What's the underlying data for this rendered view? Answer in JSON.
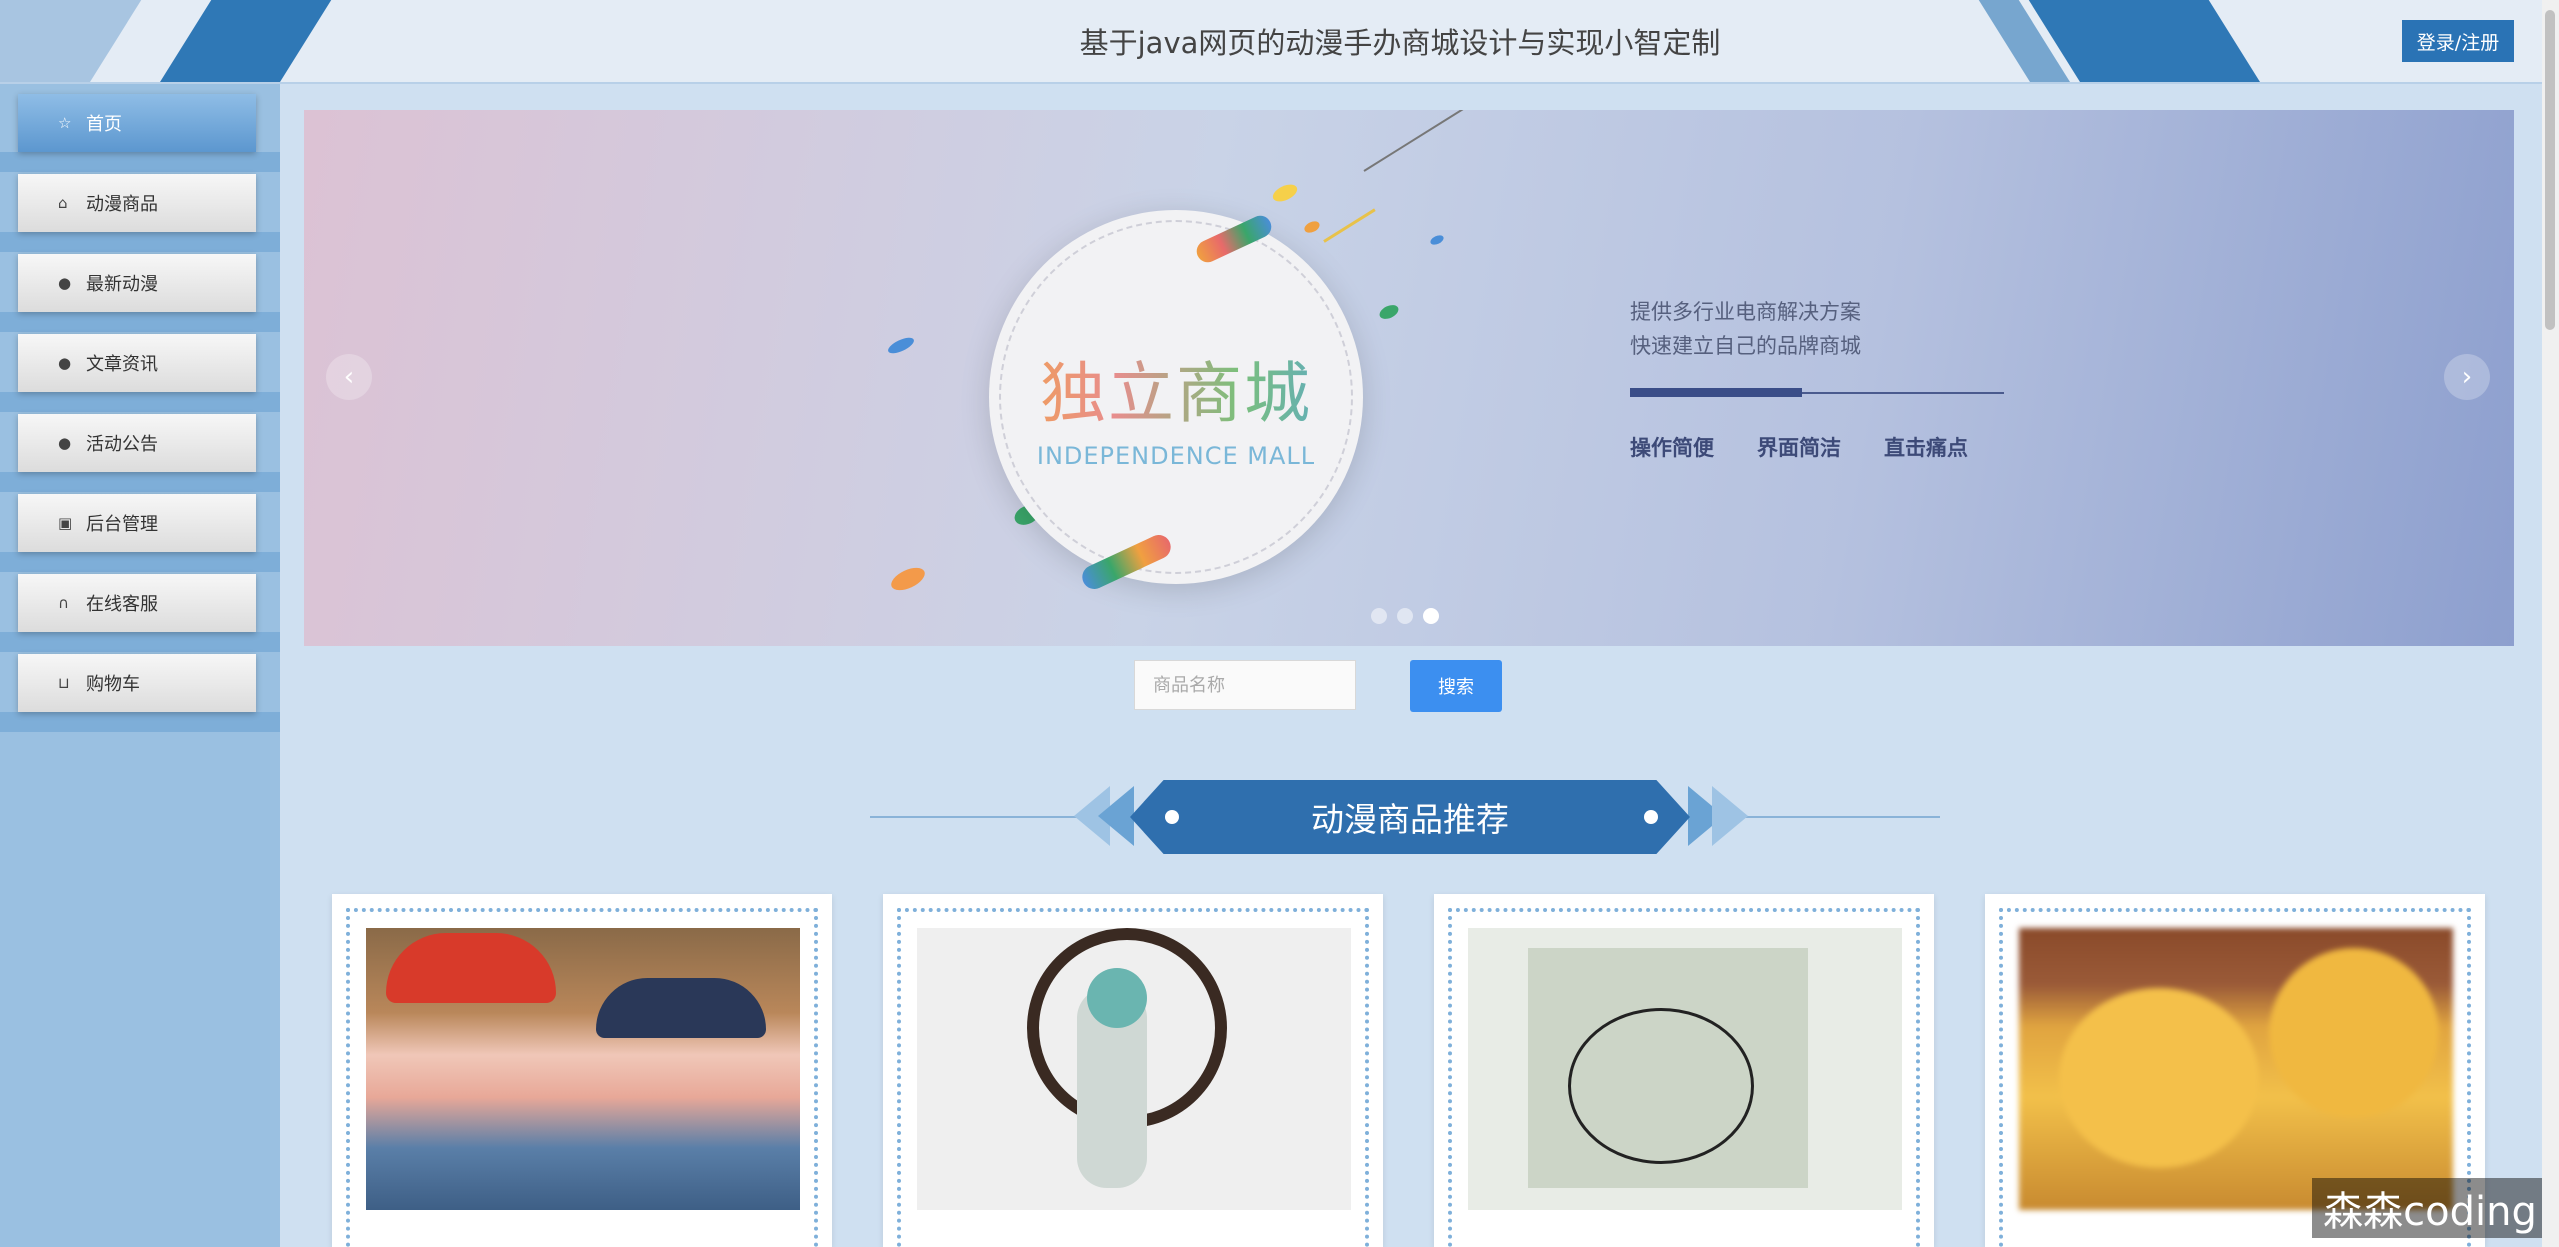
{
  "header": {
    "title": "基于java网页的动漫手办商城设计与实现小智定制",
    "login_label": "登录/注册"
  },
  "sidebar": {
    "items": [
      {
        "label": "首页",
        "icon": "star-icon"
      },
      {
        "label": "动漫商品",
        "icon": "bag-icon"
      },
      {
        "label": "最新动漫",
        "icon": "alert-circle-icon"
      },
      {
        "label": "文章资讯",
        "icon": "question-circle-icon"
      },
      {
        "label": "活动公告",
        "icon": "info-circle-icon"
      },
      {
        "label": "后台管理",
        "icon": "briefcase-icon"
      },
      {
        "label": "在线客服",
        "icon": "headset-icon"
      },
      {
        "label": "购物车",
        "icon": "cart-icon"
      }
    ]
  },
  "banner": {
    "logo_cn": "独立商城",
    "logo_en": "INDEPENDENCE MALL",
    "line1": "提供多行业电商解决方案",
    "line2": "快速建立自己的品牌商城",
    "features": [
      "操作简便",
      "界面简洁",
      "直击痛点"
    ],
    "prev": "‹",
    "next": "›",
    "active_slide": 3,
    "slide_count": 3
  },
  "search": {
    "placeholder": "商品名称",
    "button": "搜索"
  },
  "section": {
    "title": "动漫商品推荐"
  },
  "products": [
    {
      "image": "pig-plush-image"
    },
    {
      "image": "figure-girl-image"
    },
    {
      "image": "sketch-art-image"
    },
    {
      "image": "tiger-plush-image"
    }
  ],
  "watermark": "森森coding",
  "colors": {
    "brand": "#2a73b5",
    "search_button": "#3c8ff0",
    "sidebar": "#9ac0e1"
  }
}
